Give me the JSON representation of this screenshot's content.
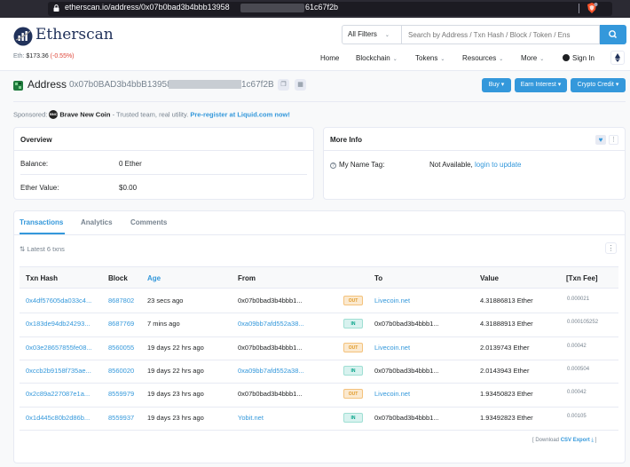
{
  "browser": {
    "url": "etherscan.io/address/0x07b0bad3b4bbb13958",
    "url_tail": "61c67f2b"
  },
  "header": {
    "logo_text": "Etherscan",
    "eth_label": "Eth: ",
    "eth_price": "$173.36",
    "eth_change": "(-0.55%)",
    "filter_label": "All Filters",
    "search_placeholder": "Search by Address / Txn Hash / Block / Token / Ens",
    "nav": {
      "home": "Home",
      "blockchain": "Blockchain",
      "tokens": "Tokens",
      "resources": "Resources",
      "more": "More",
      "signin": "Sign In"
    }
  },
  "address": {
    "title": "Address",
    "hash_head": "0x07b0BAD3b4bbB13958",
    "hash_tail": "1c67f2B",
    "buttons": {
      "buy": "Buy",
      "earn": "Earn Interest",
      "credit": "Crypto Credit"
    }
  },
  "sponsored": {
    "prefix": "Sponsored:",
    "badge": "BNC",
    "name": "Brave New Coin",
    "text": " - Trusted team, real utility. ",
    "link": "Pre-register at Liquid.com now!"
  },
  "overview": {
    "title": "Overview",
    "balance_label": "Balance:",
    "balance_value": "0 Ether",
    "ether_value_label": "Ether Value:",
    "ether_value": "$0.00"
  },
  "more_info": {
    "title": "More Info",
    "tag_label": "My Name Tag:",
    "tag_value": "Not Available, ",
    "tag_link": "login to update"
  },
  "tabs": {
    "transactions": "Transactions",
    "analytics": "Analytics",
    "comments": "Comments"
  },
  "txns": {
    "latest": "Latest 6 txns",
    "headers": {
      "hash": "Txn Hash",
      "block": "Block",
      "age": "Age",
      "from": "From",
      "to": "To",
      "value": "Value",
      "fee": "[Txn Fee]"
    },
    "rows": [
      {
        "hash": "0x4df57605da033c4...",
        "block": "8687802",
        "age": "23 secs ago",
        "from": "0x07b0bad3b4bbb1...",
        "dir": "OUT",
        "to": "Livecoin.net",
        "value": "4.31886813 Ether",
        "fee": "0.000021"
      },
      {
        "hash": "0x183de94db24293...",
        "block": "8687769",
        "age": "7 mins ago",
        "from": "0xa09bb7afd552a38...",
        "dir": "IN",
        "to": "0x07b0bad3b4bbb1...",
        "value": "4.31888913 Ether",
        "fee": "0.000105252"
      },
      {
        "hash": "0x03e28657855fe08...",
        "block": "8560055",
        "age": "19 days 22 hrs ago",
        "from": "0x07b0bad3b4bbb1...",
        "dir": "OUT",
        "to": "Livecoin.net",
        "value": "2.0139743 Ether",
        "fee": "0.00042"
      },
      {
        "hash": "0xccb2b9158f735ae...",
        "block": "8560020",
        "age": "19 days 22 hrs ago",
        "from": "0xa09bb7afd552a38...",
        "dir": "IN",
        "to": "0x07b0bad3b4bbb1...",
        "value": "2.0143943 Ether",
        "fee": "0.000504"
      },
      {
        "hash": "0x2c89a227087e1a...",
        "block": "8559979",
        "age": "19 days 23 hrs ago",
        "from": "0x07b0bad3b4bbb1...",
        "dir": "OUT",
        "to": "Livecoin.net",
        "value": "1.93450823 Ether",
        "fee": "0.00042"
      },
      {
        "hash": "0x1d445c80b2d86b...",
        "block": "8559937",
        "age": "19 days 23 hrs ago",
        "from": "Yobit.net",
        "dir": "IN",
        "to": "0x07b0bad3b4bbb1...",
        "value": "1.93492823 Ether",
        "fee": "0.00105"
      }
    ],
    "csv_prefix": "[ Download ",
    "csv_link": "CSV Export",
    "csv_suffix": " ]"
  },
  "colors": {
    "accent": "#3498db",
    "out_badge": "#e09b2b",
    "in_badge": "#00a186",
    "negative": "#de4437"
  }
}
